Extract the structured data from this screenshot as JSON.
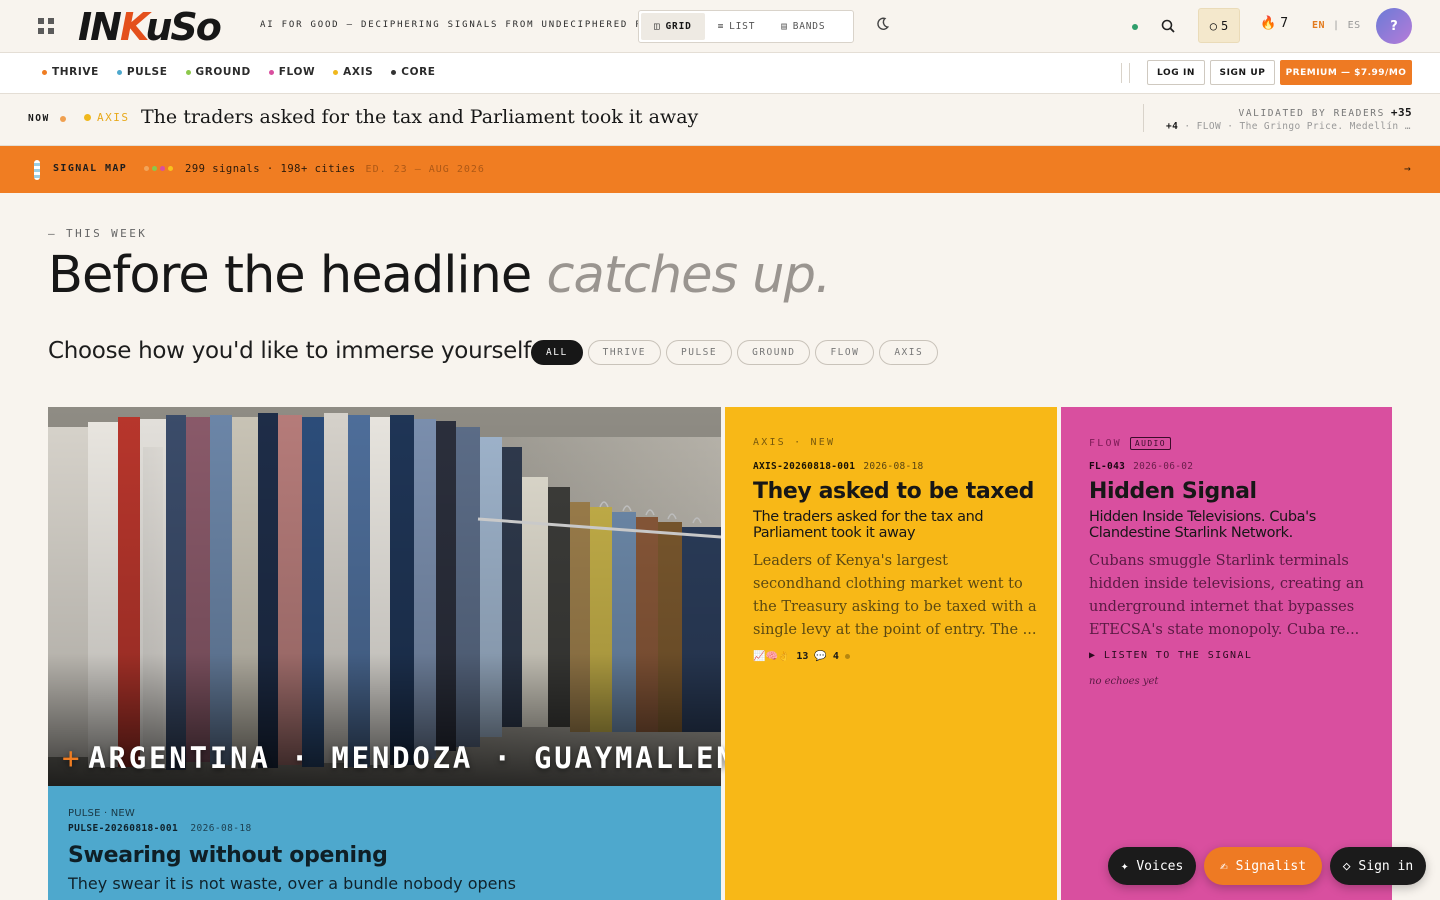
{
  "header": {
    "logo_main": "IN",
    "logo_accent": "K",
    "logo_rest": "uSo",
    "tagline": "AI FOR GOOD — DECIPHERING SIGNALS FROM UNDECIPHERED PLACES",
    "views": [
      {
        "label": "GRID",
        "icon": "grid-view-icon",
        "active": true
      },
      {
        "label": "LIST",
        "icon": "list-view-icon",
        "active": false
      },
      {
        "label": "BANDS",
        "icon": "bands-view-icon",
        "active": false
      }
    ],
    "signal_count": "5",
    "streak_count": "7",
    "lang_en": "EN",
    "lang_sep": "|",
    "lang_es": "ES",
    "avatar_label": "?"
  },
  "nav": {
    "categories": [
      {
        "label": "THRIVE",
        "color": "#ef7d22"
      },
      {
        "label": "PULSE",
        "color": "#4ea8cd"
      },
      {
        "label": "GROUND",
        "color": "#8cc84b"
      },
      {
        "label": "FLOW",
        "color": "#d94f9f"
      },
      {
        "label": "AXIS",
        "color": "#f0b81d"
      },
      {
        "label": "CORE",
        "color": "#333333"
      }
    ],
    "login": "LOG IN",
    "signup": "SIGN UP",
    "premium": "PREMIUM — $7.99/MO"
  },
  "ticker": {
    "now_label": "NOW",
    "tag": "AXIS",
    "headline": "The traders asked for the tax and Parliament took it away",
    "validated_label": "VALIDATED BY READERS",
    "validated_count": "+35",
    "secondary_count": "+4",
    "secondary_text": "· FLOW · The Gringo Price. Medellín B…"
  },
  "signal_map": {
    "label": "SIGNAL MAP",
    "stats": "299 signals · 198+ cities",
    "edition": "ED. 23 — AUG 2026",
    "arrow": "→"
  },
  "hero": {
    "eyebrow": "— THIS WEEK",
    "title_main": "Before the headline ",
    "title_italic": "catches up.",
    "chooser": "Choose how you'd like to immerse yourself",
    "filters": [
      "ALL",
      "THRIVE",
      "PULSE",
      "GROUND",
      "FLOW",
      "AXIS"
    ]
  },
  "featured": {
    "location": "ARGENTINA · MENDOZA · GUAYMALLEN",
    "plus": "+",
    "tag": "PULSE · NEW",
    "id": "PULSE-20260818-001",
    "date": "2026-08-18",
    "title": "Swearing without opening",
    "subtitle": "They swear it is not waste, over a bundle nobody opens"
  },
  "axis_card": {
    "tag": "AXIS · NEW",
    "id": "AXIS-20260818-001",
    "date": "2026-08-18",
    "title": "They asked to be taxed",
    "subtitle": "The traders asked for the tax and Parliament took it away",
    "body": "Leaders of Kenya's largest secondhand clothing market went to the Treasury asking to be taxed with a single levy at the point of entry. The ...",
    "reactions": "📈🧠👌",
    "reaction_count": "13",
    "comment_count": "4"
  },
  "flow_card": {
    "tag": "FLOW",
    "badge": "AUDIO",
    "id": "FL-043",
    "date": "2026-06-02",
    "title": "Hidden Signal",
    "subtitle": "Hidden Inside Televisions. Cuba's Clandestine Starlink Network.",
    "body": "Cubans smuggle Starlink terminals hidden inside televisions, creating an underground internet that bypasses ETECSA's state monopoly. Cuba re...",
    "listen": "▶ LISTEN TO THE SIGNAL",
    "echoes": "no echoes yet"
  },
  "fabs": {
    "voices": "✦ Voices",
    "signalist": "✍ Signalist",
    "signin": "◇ Sign in"
  },
  "colors": {
    "accent": "#ee7a23",
    "pulse": "#4ea8cd",
    "axis": "#f8b817",
    "flow": "#d94f9f"
  }
}
